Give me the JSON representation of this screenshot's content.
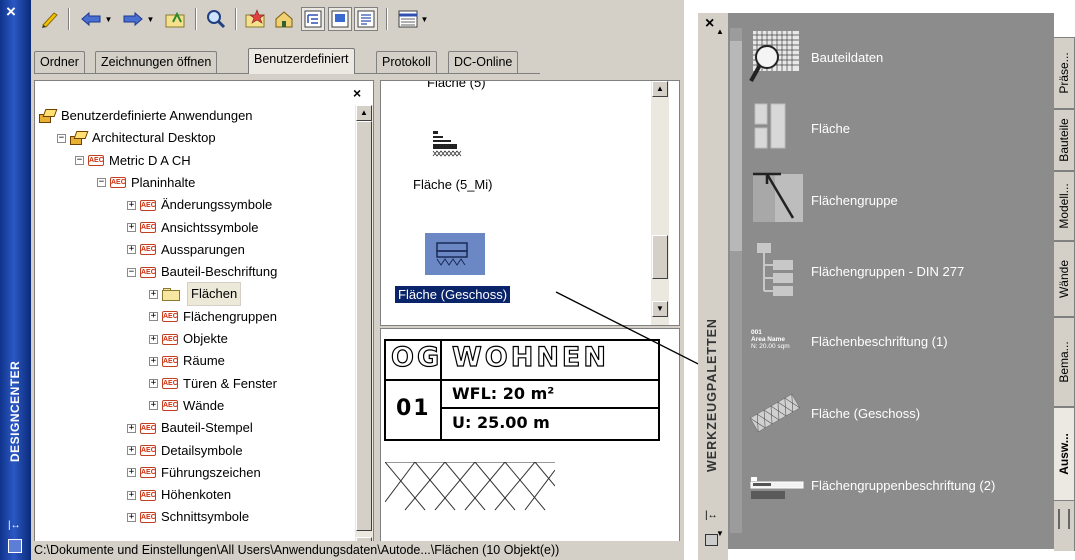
{
  "designcenter": {
    "close_glyph": "×",
    "title": "DESIGNCENTER",
    "autohide_glyph": "|↔",
    "tabs": [
      "Ordner",
      "Zeichnungen öffnen",
      "Benutzerdefiniert",
      "Protokoll",
      "DC-Online"
    ],
    "active_tab": "Benutzerdefiniert",
    "toolbar_icons": [
      "load-icon",
      "back-icon",
      "forward-icon",
      "up-folder-icon",
      "search-icon",
      "favorites-icon",
      "home-icon",
      "tree-view-toggle-icon",
      "preview-toggle-icon",
      "description-toggle-icon",
      "views-icon"
    ],
    "tree_close_glyph": "×",
    "tree": [
      {
        "label": "Benutzerdefinierte Anwendungen",
        "icon": "app-icon",
        "expander": ""
      },
      {
        "label": "Architectural Desktop",
        "icon": "app-icon",
        "expander": "−"
      },
      {
        "label": "Metric D A CH",
        "icon": "aec-icon",
        "expander": "−"
      },
      {
        "label": "Planinhalte",
        "icon": "aec-icon",
        "expander": "−"
      },
      {
        "label": "Änderungssymbole",
        "icon": "aec-icon",
        "expander": "+"
      },
      {
        "label": "Ansichtssymbole",
        "icon": "aec-icon",
        "expander": "+"
      },
      {
        "label": "Aussparungen",
        "icon": "aec-icon",
        "expander": "+"
      },
      {
        "label": "Bauteil-Beschriftung",
        "icon": "aec-icon",
        "expander": "−"
      },
      {
        "label": "Flächen",
        "icon": "folder-icon",
        "expander": "+"
      },
      {
        "label": "Flächengruppen",
        "icon": "aec-icon",
        "expander": "+"
      },
      {
        "label": "Objekte",
        "icon": "aec-icon",
        "expander": "+"
      },
      {
        "label": "Räume",
        "icon": "aec-icon",
        "expander": "+"
      },
      {
        "label": "Türen & Fenster",
        "icon": "aec-icon",
        "expander": "+"
      },
      {
        "label": "Wände",
        "icon": "aec-icon",
        "expander": "+"
      },
      {
        "label": "Bauteil-Stempel",
        "icon": "aec-icon",
        "expander": "+"
      },
      {
        "label": "Detailsymbole",
        "icon": "aec-icon",
        "expander": "+"
      },
      {
        "label": "Führungszeichen",
        "icon": "aec-icon",
        "expander": "+"
      },
      {
        "label": "Höhenkoten",
        "icon": "aec-icon",
        "expander": "+"
      },
      {
        "label": "Schnittsymbole",
        "icon": "aec-icon",
        "expander": "+"
      }
    ],
    "aec_icon_text": "AEC",
    "content_items": [
      {
        "label": "Fläche (5)"
      },
      {
        "label": "Fläche (5_Mi)"
      },
      {
        "label": "Fläche (Geschoss)",
        "selected": true
      }
    ],
    "preview": {
      "og": "OG",
      "wohnen": "WOHNEN",
      "number": "01",
      "wfl": "WFL: 20 m²",
      "u": "U: 25.00 m"
    },
    "status": "C:\\Dokumente und Einstellungen\\All Users\\Anwendungsdaten\\Autode...\\Flächen (10 Objekt(e))"
  },
  "tool_palette": {
    "close_glyph": "×",
    "title": "WERKZEUGPALETTEN",
    "autohide_glyph": "|↔",
    "tools": [
      {
        "label": "Bauteildaten",
        "icon": "bauteildaten-icon"
      },
      {
        "label": "Fläche",
        "icon": "flaeche-icon"
      },
      {
        "label": "Flächengruppe",
        "icon": "flaechengruppe-icon"
      },
      {
        "label": "Flächengruppen - DIN 277",
        "icon": "flaechengruppen-din-icon"
      },
      {
        "label": "Flächenbeschriftung (1)",
        "icon": "flaechenbeschriftung-icon"
      },
      {
        "label": "Fläche (Geschoss)",
        "icon": "flaeche-geschoss-icon"
      },
      {
        "label": "Flächengruppenbeschriftung (2)",
        "icon": "flaechengruppenbeschriftung-icon"
      }
    ],
    "tool_icon_text": {
      "area_name_1": "001",
      "area_name_2": "Area Name",
      "area_name_3": "N: 20.00 sqm"
    },
    "side_tabs": [
      "Präse...",
      "Bauteile",
      "Modell...",
      "Wände",
      "Bema...",
      "Ausw..."
    ],
    "active_side_tab": "Ausw..."
  },
  "colors": {
    "dc_title_blue": "#10348c",
    "selection_blue": "#0a246a",
    "palette_gray": "#8c8c8c",
    "panel_face": "#d4d0c8"
  }
}
